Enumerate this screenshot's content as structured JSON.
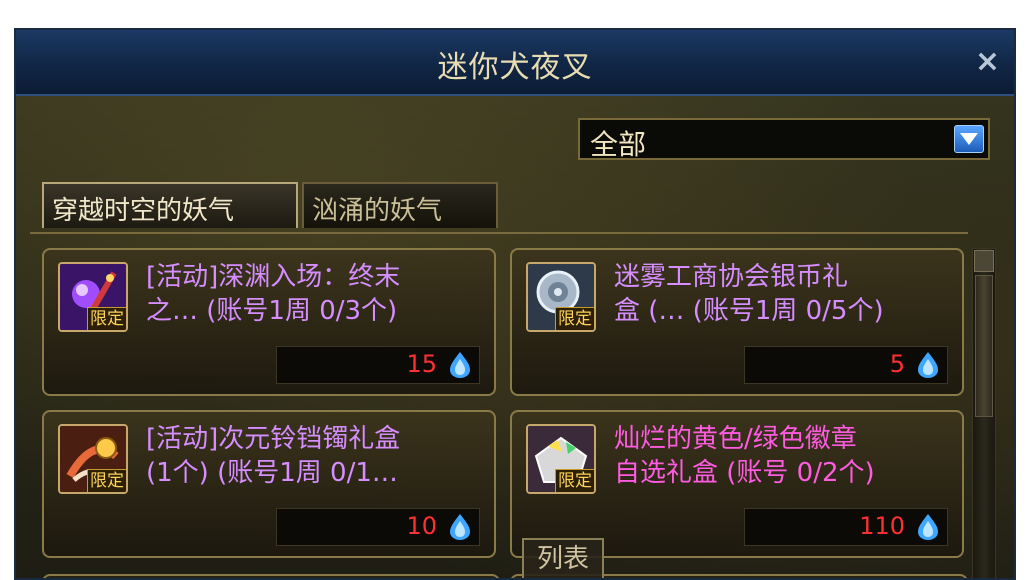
{
  "window": {
    "title": "迷你犬夜叉",
    "close_label": "×"
  },
  "filter": {
    "selected": "全部"
  },
  "tabs": [
    {
      "label": "穿越时空的妖气",
      "active": true
    },
    {
      "label": "汹涌的妖气",
      "active": false
    }
  ],
  "items": [
    {
      "name": "[活动]深渊入场：终末\n之…  (账号1周 0/3个)",
      "badge": "限定",
      "price": "15",
      "icon": "purple-gem-staff-icon"
    },
    {
      "name": "迷雾工商协会银币礼\n盒 (… (账号1周 0/5个)",
      "badge": "限定",
      "price": "5",
      "icon": "silver-coin-box-icon"
    },
    {
      "name": "[活动]次元铃铛镯礼盒\n(1个)  (账号1周 0/1…",
      "badge": "限定",
      "price": "10",
      "icon": "bell-bracelet-icon"
    },
    {
      "name": "灿烂的黄色/绿色徽章\n自选礼盒 (账号 0/2个)",
      "badge": "限定",
      "price": "110",
      "icon": "emblem-box-icon"
    }
  ],
  "list_button": "列表",
  "colors": {
    "title_bar": "#12294a",
    "price_text": "#ff3030",
    "item_name_purple": "#d58dff",
    "item_name_pink": "#ff5be0",
    "limited_badge": "#ffd35a"
  }
}
